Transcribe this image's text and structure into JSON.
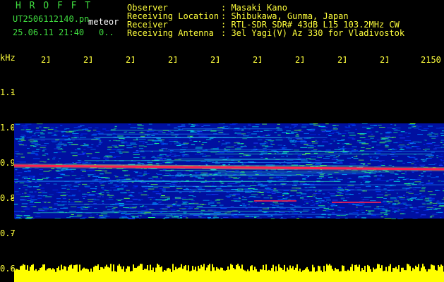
{
  "header": {
    "title": "H R O F F T",
    "filename": "UT2506112140.pn",
    "filename_suffix": "meteor",
    "date_time": "25.06.11 21:40",
    "extra": "0..",
    "info": [
      {
        "label": "Observer",
        "value": ": Masaki Kano"
      },
      {
        "label": "Receiving Location",
        "value": ": Shibukawa, Gunma, Japan"
      },
      {
        "label": "Receiver",
        "value": ": RTL-SDR SDR# 43dB L15 103.2MHz CW"
      },
      {
        "label": "Receiving Antenna",
        "value": ": 3el Yagi(V) Az 330 for Vladivostok"
      }
    ]
  },
  "axis": {
    "unit": "kHz",
    "y_ticks": [
      "1.1",
      "1.0",
      "0.9",
      "0.8",
      "0.7",
      "0.6"
    ],
    "x_ticks": [
      "214",
      "214",
      "214",
      "214",
      "214",
      "214",
      "214",
      "214",
      "214",
      "2150"
    ]
  },
  "colors": {
    "header_green": "#3fdc3f",
    "axis_yellow": "#ffff3c",
    "signal_red": "#ff2050",
    "background_blue": "#0010a0",
    "level_yellow": "#ffff00"
  },
  "chart_data": {
    "type": "heatmap",
    "y_unit": "kHz",
    "y_range": [
      0.6,
      1.15
    ],
    "band_range_khz": [
      0.78,
      1.05
    ],
    "signal_line_khz": 0.93,
    "signal_line_end_khz": 0.92,
    "secondary_line_khz": 0.83,
    "grid": false
  }
}
